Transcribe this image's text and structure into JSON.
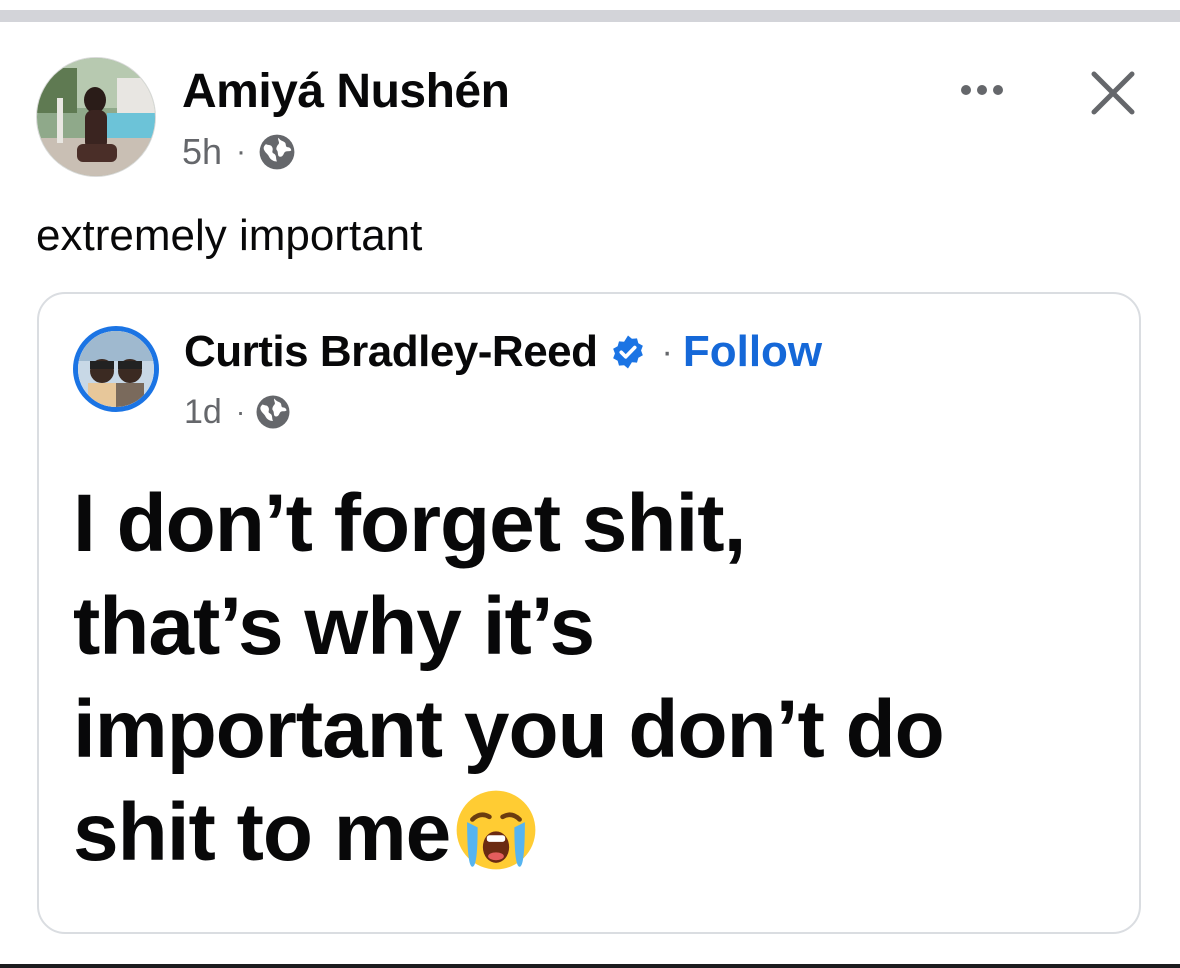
{
  "post": {
    "author": "Amiyá Nushén",
    "time": "5h",
    "separator": "·",
    "caption": "extremely important",
    "avatar_icon": "profile-photo",
    "visibility_icon": "globe-icon"
  },
  "actions": {
    "more_icon": "more-options-icon",
    "close_icon": "close-icon"
  },
  "shared_post": {
    "author": "Curtis Bradley-Reed",
    "verified_icon": "verified-badge-icon",
    "separator": "·",
    "follow_label": "Follow",
    "time": "1d",
    "visibility_icon": "globe-icon",
    "text_lines": [
      "I don’t forget shit,",
      "that’s why it’s",
      "important you don’t do",
      "shit to me"
    ],
    "emoji_icon": "loudly-crying-face-emoji"
  },
  "colors": {
    "link_blue": "#1568d8",
    "secondary_text": "#65676b",
    "card_border": "#dadde1",
    "avatar_ring": "#1b74e4"
  }
}
